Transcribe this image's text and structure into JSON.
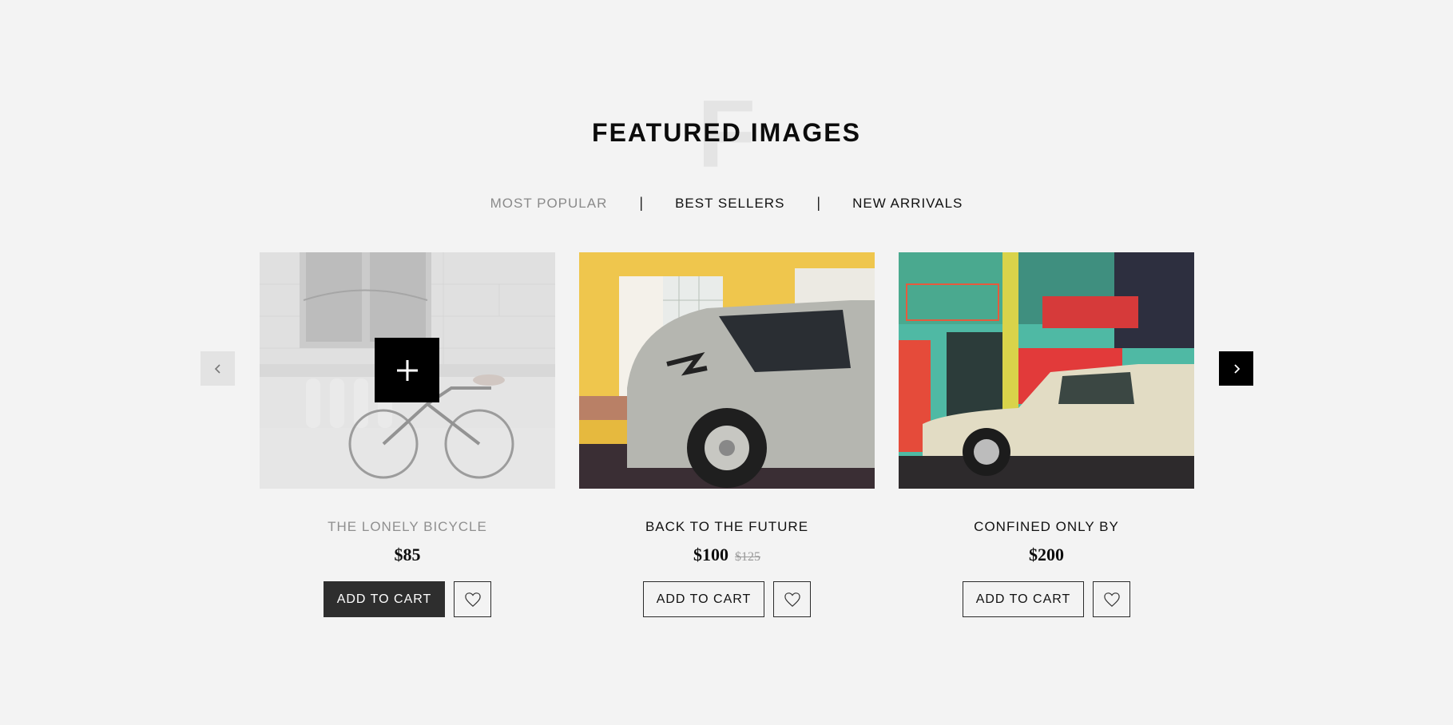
{
  "section": {
    "title": "FEATURED IMAGES",
    "title_bg_letter": "F"
  },
  "tabs": [
    {
      "label": "MOST POPULAR",
      "active": false
    },
    {
      "label": "BEST SELLERS",
      "active": true
    },
    {
      "label": "NEW ARRIVALS",
      "active": true
    }
  ],
  "tab_separator": "|",
  "carousel": {
    "prev_icon": "chevron-left-icon",
    "next_icon": "chevron-right-icon"
  },
  "products": [
    {
      "name": "THE LONELY BICYCLE",
      "price": "$85",
      "old_price": "",
      "cart_label": "ADD TO CART",
      "hovered": true
    },
    {
      "name": "BACK TO THE FUTURE",
      "price": "$100",
      "old_price": "$125",
      "cart_label": "ADD TO CART",
      "hovered": false
    },
    {
      "name": "CONFINED ONLY BY",
      "price": "$200",
      "old_price": "",
      "cart_label": "ADD TO CART",
      "hovered": false
    }
  ],
  "colors": {
    "background": "#f3f3f3",
    "dark": "#000000",
    "muted": "#8a8a8a"
  }
}
